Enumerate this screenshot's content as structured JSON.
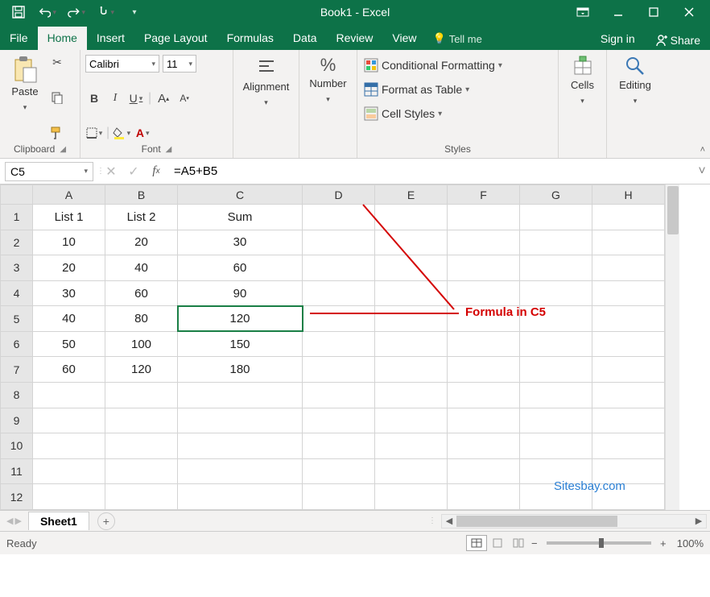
{
  "app": {
    "title": "Book1 - Excel"
  },
  "menu": {
    "tabs": [
      "File",
      "Home",
      "Insert",
      "Page Layout",
      "Formulas",
      "Data",
      "Review",
      "View"
    ],
    "active_index": 1,
    "tellme": "Tell me",
    "signin": "Sign in",
    "share": "Share"
  },
  "ribbon": {
    "clipboard": {
      "label": "Clipboard",
      "paste": "Paste"
    },
    "font": {
      "label": "Font",
      "name": "Calibri",
      "size": "11"
    },
    "alignment": {
      "label": "Alignment"
    },
    "number": {
      "label": "Number"
    },
    "styles": {
      "label": "Styles",
      "conditional": "Conditional Formatting",
      "table": "Format as Table",
      "cellstyles": "Cell Styles"
    },
    "cells": {
      "label": "Cells"
    },
    "editing": {
      "label": "Editing"
    }
  },
  "formula_bar": {
    "name_box": "C5",
    "formula": "=A5+B5"
  },
  "grid": {
    "columns": [
      "A",
      "B",
      "C",
      "D",
      "E",
      "F",
      "G",
      "H"
    ],
    "rows": [
      {
        "n": "1",
        "A": "List 1",
        "B": "List 2",
        "C": "Sum",
        "D": "",
        "E": "",
        "F": "",
        "G": "",
        "H": ""
      },
      {
        "n": "2",
        "A": "10",
        "B": "20",
        "C": "30",
        "D": "",
        "E": "",
        "F": "",
        "G": "",
        "H": ""
      },
      {
        "n": "3",
        "A": "20",
        "B": "40",
        "C": "60",
        "D": "",
        "E": "",
        "F": "",
        "G": "",
        "H": ""
      },
      {
        "n": "4",
        "A": "30",
        "B": "60",
        "C": "90",
        "D": "",
        "E": "",
        "F": "",
        "G": "",
        "H": ""
      },
      {
        "n": "5",
        "A": "40",
        "B": "80",
        "C": "120",
        "D": "",
        "E": "",
        "F": "",
        "G": "",
        "H": ""
      },
      {
        "n": "6",
        "A": "50",
        "B": "100",
        "C": "150",
        "D": "",
        "E": "",
        "F": "",
        "G": "",
        "H": ""
      },
      {
        "n": "7",
        "A": "60",
        "B": "120",
        "C": "180",
        "D": "",
        "E": "",
        "F": "",
        "G": "",
        "H": ""
      },
      {
        "n": "8",
        "A": "",
        "B": "",
        "C": "",
        "D": "",
        "E": "",
        "F": "",
        "G": "",
        "H": ""
      },
      {
        "n": "9",
        "A": "",
        "B": "",
        "C": "",
        "D": "",
        "E": "",
        "F": "",
        "G": "",
        "H": ""
      },
      {
        "n": "10",
        "A": "",
        "B": "",
        "C": "",
        "D": "",
        "E": "",
        "F": "",
        "G": "",
        "H": ""
      },
      {
        "n": "11",
        "A": "",
        "B": "",
        "C": "",
        "D": "",
        "E": "",
        "F": "",
        "G": "",
        "H": ""
      },
      {
        "n": "12",
        "A": "",
        "B": "",
        "C": "",
        "D": "",
        "E": "",
        "F": "",
        "G": "",
        "H": ""
      }
    ],
    "selected": {
      "row_index": 4,
      "col": "C"
    }
  },
  "annotations": {
    "formula_label": "Formula in C5",
    "watermark": "Sitesbay.com"
  },
  "sheet_tabs": {
    "active": "Sheet1"
  },
  "status": {
    "ready": "Ready",
    "zoom": "100%"
  },
  "chart_data": {
    "type": "table",
    "headers": [
      "List 1",
      "List 2",
      "Sum"
    ],
    "rows": [
      [
        10,
        20,
        30
      ],
      [
        20,
        40,
        60
      ],
      [
        30,
        60,
        90
      ],
      [
        40,
        80,
        120
      ],
      [
        50,
        100,
        150
      ],
      [
        60,
        120,
        180
      ]
    ],
    "selected_cell": "C5",
    "selected_formula": "=A5+B5"
  }
}
